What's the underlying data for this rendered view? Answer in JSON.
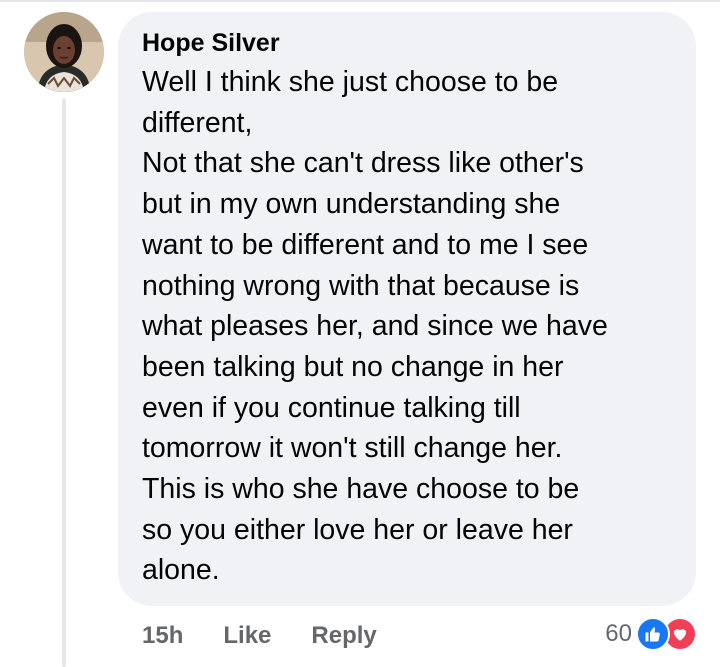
{
  "comment": {
    "author": "Hope Silver",
    "lines": [
      "Well I think she just choose to be",
      "different,",
      "Not that she can't dress like other's",
      "but in my own understanding she",
      "want to be different and to me I see",
      "nothing wrong with that because is",
      "what pleases her, and since we have",
      "been talking but no change in her",
      "even if you continue talking till",
      "tomorrow it won't still change her.",
      "This is who she have choose to be",
      "so you either love her or leave her",
      "alone."
    ],
    "timestamp": "15h",
    "actions": {
      "like_label": "Like",
      "reply_label": "Reply"
    },
    "reactions": {
      "count": "60",
      "types": [
        "like-icon",
        "love-icon"
      ]
    }
  },
  "colors": {
    "bubble_bg": "#f0f2f5",
    "text": "#050505",
    "secondary_text": "#65676b",
    "like_blue": "#1877f2",
    "love_red": "#f33e58"
  }
}
